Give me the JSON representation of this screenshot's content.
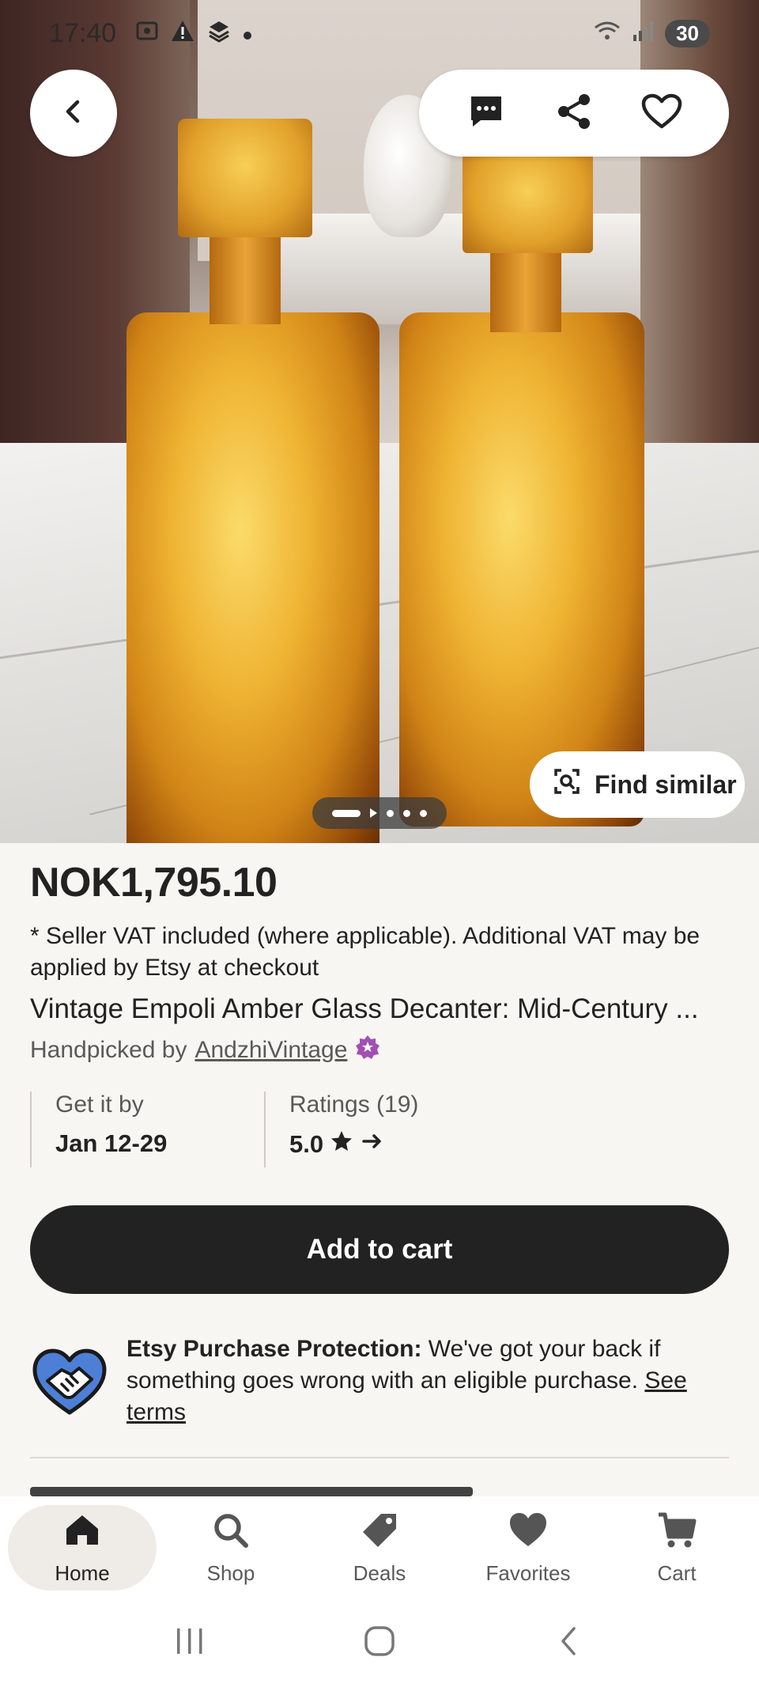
{
  "status_bar": {
    "time": "17:40",
    "battery": "30"
  },
  "hero": {
    "find_similar_label": "Find similar",
    "image_count": 5,
    "current_image": 1
  },
  "product": {
    "price": "NOK1,795.10",
    "vat_note": "* Seller VAT included (where applicable). Additional VAT may be applied by Etsy at checkout",
    "title": "Vintage Empoli Amber Glass Decanter: Mid-Century ...",
    "handpicked_prefix": "Handpicked by",
    "shop_name": "AndzhiVintage"
  },
  "meta": {
    "delivery_label": "Get it by",
    "delivery_value": "Jan 12-29",
    "ratings_label": "Ratings (19)",
    "ratings_value": "5.0"
  },
  "cart_button": "Add to cart",
  "protection": {
    "bold": "Etsy Purchase Protection:",
    "text": " We've got your back if something goes wrong with an eligible purchase. ",
    "link": "See terms"
  },
  "bottom_nav": {
    "home": "Home",
    "shop": "Shop",
    "deals": "Deals",
    "favorites": "Favorites",
    "cart": "Cart"
  },
  "colors": {
    "primary": "#222222",
    "background": "#f8f6f3",
    "star_seller_badge": "#a24fb4",
    "protection_icon_blue": "#4d7fd6"
  }
}
